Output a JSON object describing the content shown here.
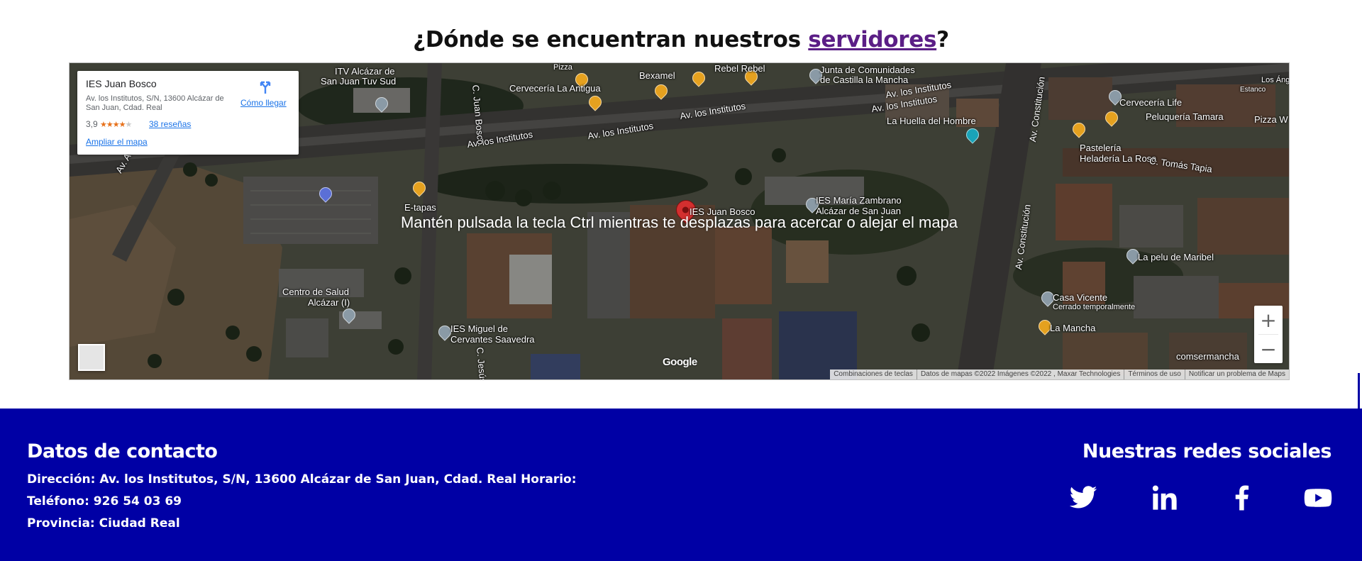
{
  "heading": {
    "prefix": "¿Dónde se encuentran nuestros ",
    "link": "servidores",
    "suffix": "?"
  },
  "map": {
    "ctrl_message": "Mantén pulsada la tecla Ctrl mientras te desplazas para acercar o alejar el mapa",
    "info_card": {
      "name": "IES Juan Bosco",
      "address": "Av. los Institutos, S/N, 13600 Alcázar de San Juan, Cdad. Real",
      "rating": "3,9",
      "reviews": "38 reseñas",
      "enlarge": "Ampliar el mapa",
      "directions": "Cómo llegar"
    },
    "labels": {
      "itv": "ITV Alcázar de",
      "itv2": "San Juan Tuv Sud",
      "pizza": "Pizza",
      "bexamel": "Bexamel",
      "rebel": "Rebel Rebel",
      "junta": "Junta de Comunidades",
      "junta2": "de Castilla la Mancha",
      "cerveceria_antigua": "Cervecería La Antigua",
      "cerveceria_life": "Cervecería Life",
      "peluqueria_tamara": "Peluquería Tamara",
      "pizza_w": "Pizza W",
      "los_angeles": "Los Ánge",
      "estanco": "Estanco",
      "huella": "La Huella del Hombre",
      "pasteleria": "Pastelería",
      "heladeria": "Heladería La Rosa",
      "tomas_tapia": "C. Tomás Tapia",
      "av_institutos_1": "Av. los Institutos",
      "av_institutos_2": "Av. los Institutos",
      "av_institutos_3": "Av. los Institutos",
      "av_institutos_4": "Av. los Institutos",
      "av_institutos_5": "Av. los Institutos",
      "juan_bosco_street": "C. Juan Bosco",
      "av_constitucion_1": "Av. Constitución",
      "av_constitucion_2": "Av. Constitución",
      "etapas": "E-tapas",
      "ies_juan_bosco": "IES Juan Bosco",
      "ies_zambrano": "IES María Zambrano",
      "ies_zambrano2": "Alcázar de San Juan",
      "pelu_maribel": "La pelu de Maribel",
      "centro_salud": "Centro de Salud",
      "centro_salud2": "Alcázar (I)",
      "casa_vicente": "Casa Vicente",
      "cerrado": "Cerrado temporalmente",
      "la_mancha": "La Mancha",
      "ies_miguel": "IES Miguel de",
      "ies_miguel2": "Cervantes Saavedra",
      "comsermancha": "comsermancha",
      "c_jesus": "C. Jesús",
      "av_a": "Av. A"
    },
    "google_logo": "Google",
    "attribution": [
      "Combinaciones de teclas",
      "Datos de mapas ©2022 Imágenes ©2022 , Maxar Technologies",
      "Términos de uso",
      "Notificar un problema de Maps"
    ],
    "zoom_in": "+",
    "zoom_out": "−"
  },
  "footer": {
    "contact_title": "Datos de contacto",
    "address_line": "Dirección: Av. los Institutos, S/N, 13600 Alcázar de San Juan, Cdad. Real Horario:",
    "phone_line": "Teléfono: 926 54 03 69",
    "province_line": "Provincia: Ciudad Real",
    "social_title": "Nuestras redes sociales",
    "social_icons": [
      "twitter-icon",
      "linkedin-icon",
      "facebook-icon",
      "youtube-icon"
    ]
  },
  "colors": {
    "footer_bg": "#0000a5",
    "link": "#5b1e86",
    "map_link": "#1a73e8"
  }
}
